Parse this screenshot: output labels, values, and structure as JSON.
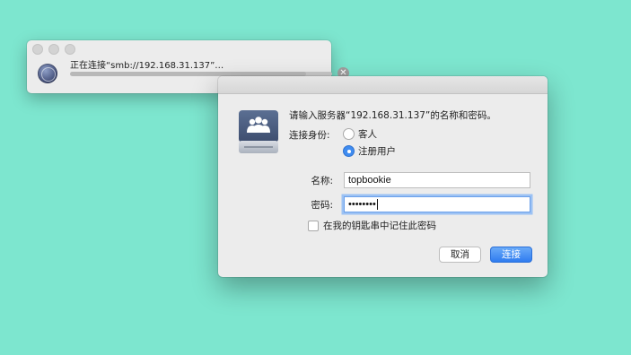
{
  "connecting_window": {
    "message": "正在连接“smb://192.168.31.137”…",
    "progress": 0.9
  },
  "login_dialog": {
    "prompt": "请输入服务器“192.168.31.137”的名称和密码。",
    "connect_as_label": "连接身份:",
    "options": [
      {
        "label": "客人",
        "selected": false
      },
      {
        "label": "注册用户",
        "selected": true
      }
    ],
    "name_label": "名称:",
    "name_value": "topbookie",
    "password_label": "密码:",
    "password_value": "••••••••",
    "remember_label": "在我的钥匙串中记住此密码",
    "cancel_label": "取消",
    "connect_label": "连接"
  },
  "colors": {
    "background": "#7de6cf",
    "accent": "#3f8cf0"
  },
  "icons": {
    "server": "file-server-icon",
    "globe": "network-globe-icon",
    "stop": "stop-icon"
  }
}
